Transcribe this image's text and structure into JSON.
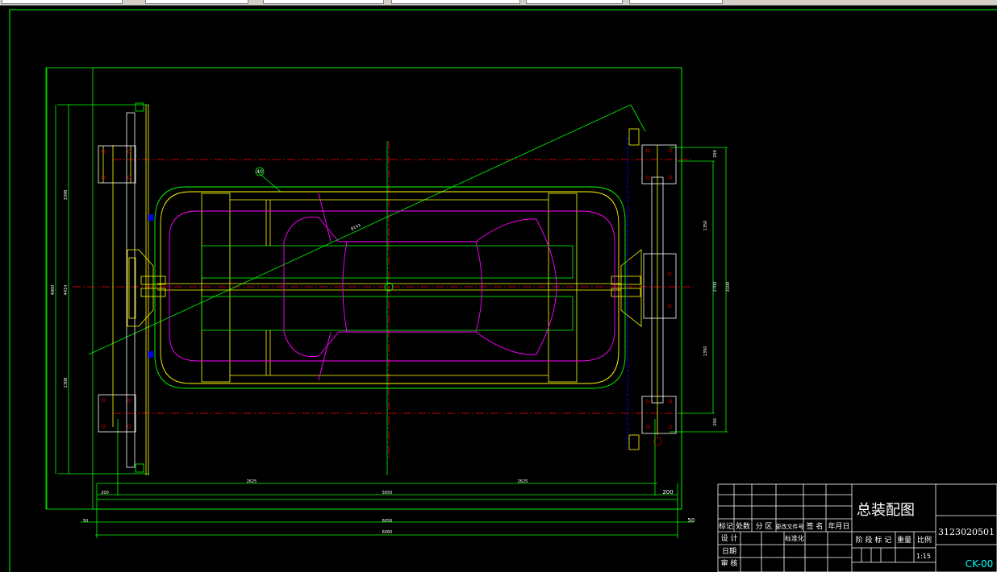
{
  "drawing": {
    "balloon_label": "40",
    "diagonal_label": "8143",
    "dims": {
      "left_total": "4800",
      "left_inner": "4414",
      "left_upper": "3398",
      "left_lower": "2308",
      "right_top_small": "200",
      "right_upper": "1350",
      "right_middle": "2700",
      "right_total": "3100",
      "right_lower": "1350",
      "right_bottom_small": "200",
      "bottom_left_small": "200",
      "bottom_seg1": "2625",
      "bottom_seg2": "2625",
      "bottom_mid": "5650",
      "bottom_right_small": "200",
      "bottom_left_50": "50",
      "bottom_right_50": "50",
      "bottom_total1": "6050",
      "bottom_total2": "6060"
    }
  },
  "title_block": {
    "drawing_title": "总装配图",
    "drawing_number": "3123020501",
    "drawing_code": "CK-00",
    "scale": "1:15",
    "headers": [
      "标记",
      "处数",
      "分 区",
      "更改文件号",
      "签 名",
      "年月日"
    ],
    "row_labels": [
      "设 计",
      "日期",
      "审 核"
    ],
    "standardize": "标准化",
    "stage_headers": [
      "阶 段 标 记",
      "重量",
      "比例"
    ]
  },
  "colors": {
    "frame": "#00ff00",
    "structure": "#ffff00",
    "car": "#ff00ff",
    "centerline": "#ff0000",
    "aux": "#0000ff",
    "code": "#00ffff",
    "background": "#000000"
  }
}
